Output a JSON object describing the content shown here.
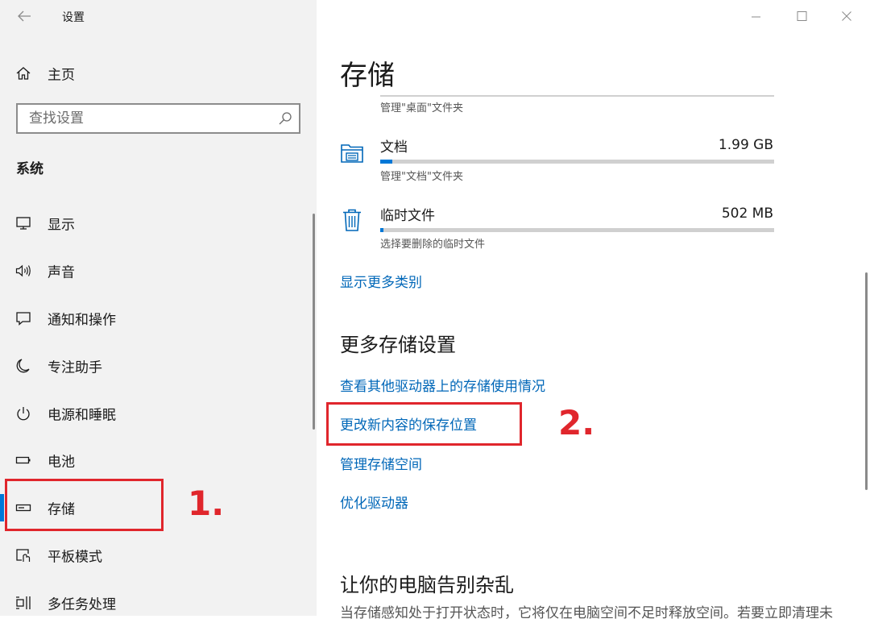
{
  "window": {
    "title": "设置",
    "controls": {
      "minimize": "minimize-icon",
      "maximize": "maximize-icon",
      "close": "close-icon"
    }
  },
  "sidebar": {
    "home_label": "主页",
    "search": {
      "placeholder": "查找设置"
    },
    "section_title": "系统",
    "items": [
      {
        "label": "显示",
        "icon": "display-icon"
      },
      {
        "label": "声音",
        "icon": "speaker-icon"
      },
      {
        "label": "通知和操作",
        "icon": "notification-icon"
      },
      {
        "label": "专注助手",
        "icon": "moon-icon"
      },
      {
        "label": "电源和睡眠",
        "icon": "power-icon"
      },
      {
        "label": "电池",
        "icon": "battery-icon"
      },
      {
        "label": "存储",
        "icon": "storage-drive-icon",
        "selected": true
      },
      {
        "label": "平板模式",
        "icon": "tablet-mode-icon"
      },
      {
        "label": "多任务处理",
        "icon": "multitasking-icon"
      }
    ]
  },
  "annotations": {
    "step1": "1.",
    "step2": "2."
  },
  "main": {
    "title": "存储",
    "desktop_caption": "管理\"桌面\"文件夹",
    "categories": [
      {
        "name": "文档",
        "size": "1.99 GB",
        "caption": "管理\"文档\"文件夹",
        "fill_fraction": 0.03,
        "icon": "documents-folder-icon"
      },
      {
        "name": "临时文件",
        "size": "502 MB",
        "caption": "选择要删除的临时文件",
        "fill_fraction": 0.008,
        "icon": "trash-icon"
      }
    ],
    "show_more": "显示更多类别",
    "more_settings": {
      "heading": "更多存储设置",
      "links": [
        "查看其他驱动器上的存储使用情况",
        "更改新内容的保存位置",
        "管理存储空间",
        "优化驱动器"
      ]
    },
    "declutter": {
      "heading": "让你的电脑告别杂乱",
      "text": "当存储感知处于打开状态时，它将仅在电脑空间不足时释放空间。若要立即清理未"
    },
    "accent_color": "#0078d7",
    "link_color": "#0067b8",
    "highlight_color": "#e0262c"
  }
}
